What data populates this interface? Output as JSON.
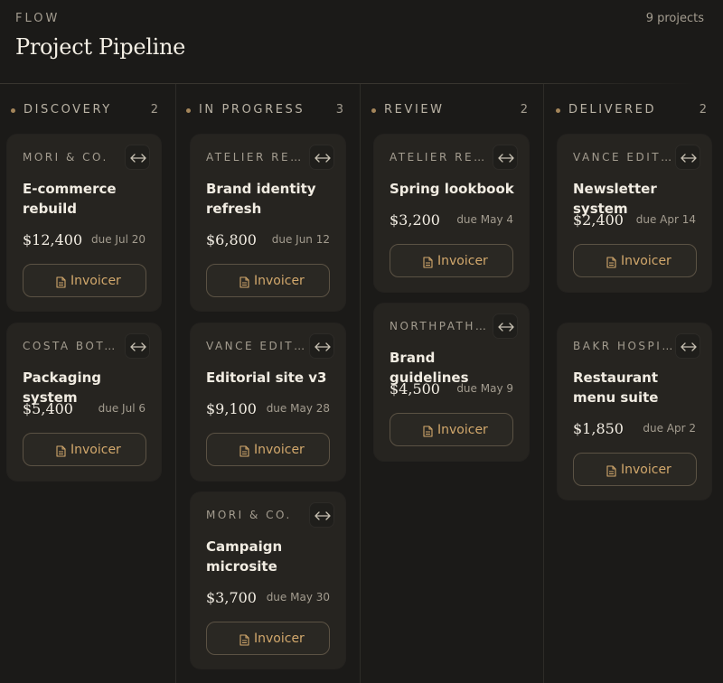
{
  "header": {
    "eyebrow": "FLOW",
    "title": "Project Pipeline",
    "project_count": "9 projects"
  },
  "colors": {
    "accent": "#d2a86c",
    "background": "#1b1a18",
    "card": "#262420",
    "dot": "#a4855a"
  },
  "icons": {
    "move": "arrows-horizontal-icon",
    "invoice": "document-icon"
  },
  "invoice_label": "Invoicer",
  "columns": [
    {
      "title": "DISCOVERY",
      "count": "2",
      "cards": [
        {
          "client": "MORI & CO.",
          "title": "E-commerce rebuild",
          "amount": "$12,400",
          "due": "due Jul 20"
        },
        {
          "client": "COSTA BOTANICALS",
          "title": "Packaging system",
          "amount": "$5,400",
          "due": "due Jul 6"
        }
      ]
    },
    {
      "title": "IN PROGRESS",
      "count": "3",
      "cards": [
        {
          "client": "ATELIER REYNAUD",
          "title": "Brand identity refresh",
          "amount": "$6,800",
          "due": "due Jun 12"
        },
        {
          "client": "VANCE EDITIONS",
          "title": "Editorial site v3",
          "amount": "$9,100",
          "due": "due May 28"
        },
        {
          "client": "MORI & CO.",
          "title": "Campaign microsite",
          "amount": "$3,700",
          "due": "due May 30"
        }
      ]
    },
    {
      "title": "REVIEW",
      "count": "2",
      "cards": [
        {
          "client": "ATELIER REYNAUD",
          "title": "Spring lookbook",
          "amount": "$3,200",
          "due": "due May 4"
        },
        {
          "client": "NORTHPATH STUDIO",
          "title": "Brand guidelines",
          "amount": "$4,500",
          "due": "due May 9"
        }
      ]
    },
    {
      "title": "DELIVERED",
      "count": "2",
      "cards": [
        {
          "client": "VANCE EDITIONS",
          "title": "Newsletter system",
          "amount": "$2,400",
          "due": "due Apr 14"
        },
        {
          "client": "BAKR HOSPITALITY",
          "title": "Restaurant menu suite",
          "amount": "$1,850",
          "due": "due Apr 2"
        }
      ]
    }
  ]
}
